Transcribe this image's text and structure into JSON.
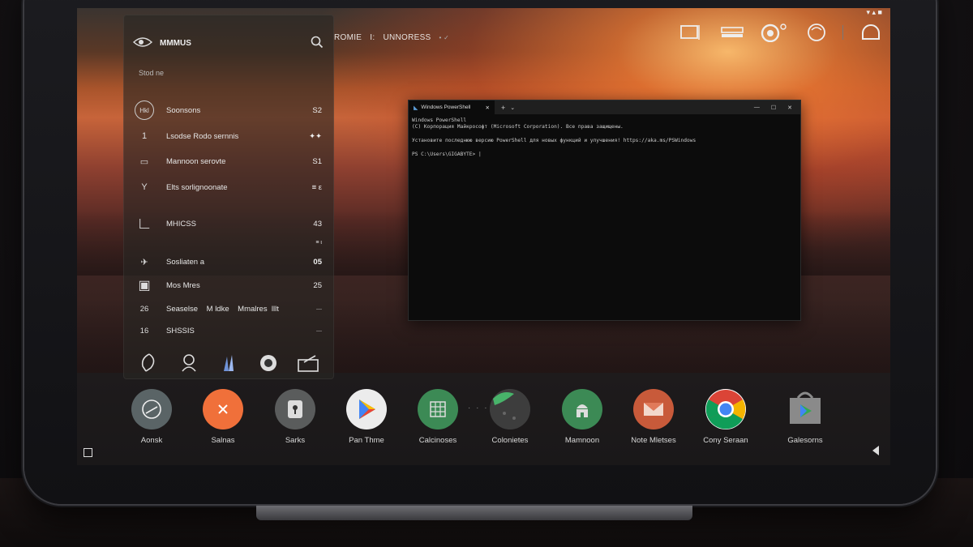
{
  "status_bar": {
    "text": "▾ ▴ ■"
  },
  "top_bar": {
    "title": "ROMIE",
    "separator": "I:",
    "subtitle": "UNNORESS",
    "suffix": "• ✓",
    "icons": [
      "screen-icon",
      "keyboard-icon",
      "camera-icon",
      "circle-icon",
      "headset-icon"
    ]
  },
  "panel": {
    "title": "MMMUS",
    "subheading": "Stod ne",
    "rows": [
      {
        "icon": "badge-icon",
        "glyph": "Hkl",
        "label": "Soonsons",
        "value": "S2"
      },
      {
        "icon": "number-icon",
        "glyph": "1",
        "label": "Lsodse Rodo sernnis",
        "value": "✦✦"
      },
      {
        "icon": "folder-icon",
        "glyph": "▭",
        "label": "Mannoon serovte",
        "value": "S1"
      },
      {
        "icon": "y-icon",
        "glyph": "Y",
        "label": "Elts sorlignoonate",
        "value": "≡ ε"
      },
      {
        "icon": "bracket-icon",
        "glyph": "∟",
        "label": "MHICSS",
        "value": "43"
      },
      {
        "icon": "plane-icon",
        "glyph": "✈",
        "label": "Sosliaten a",
        "value": "05"
      },
      {
        "icon": "truck-icon",
        "glyph": "▣",
        "label": "Mos Mres",
        "value": "25"
      },
      {
        "icon": "text-icon",
        "glyph": "26",
        "label": "Seaselse    M ldke    Mmalres  lllt",
        "value": "—"
      },
      {
        "icon": "text-icon",
        "glyph": "16",
        "label": "SHSSIS",
        "value": "—"
      }
    ],
    "small_mark": "≡ ι",
    "bottom_icons": [
      "feather-icon",
      "robot-icon",
      "chart-icon",
      "record-icon",
      "folder-edit-icon"
    ]
  },
  "powershell": {
    "tab_title": "Windows PowerShell",
    "lines": [
      "Windows PowerShell",
      "(C) Корпорация Майкрософт (Microsoft Corporation). Все права защищены.",
      "",
      "Установите последнюю версию PowerShell для новых функций и улучшения! https://aka.ms/PSWindows",
      "",
      "PS C:\\Users\\GIGABYTE> |"
    ]
  },
  "dock": {
    "items": [
      {
        "name": "aonsk",
        "label": "Aonsk",
        "icon": "steering-icon",
        "color": "#5a6466"
      },
      {
        "name": "salnas",
        "label": "Salnas",
        "icon": "close-icon",
        "color": "#f0703a"
      },
      {
        "name": "sarks",
        "label": "Sarks",
        "icon": "lock-icon",
        "color": "#5a5c5c"
      },
      {
        "name": "pan-thme",
        "label": "Pan Thme",
        "icon": "play-store-icon",
        "color": "#ececec"
      },
      {
        "name": "calcinoses",
        "label": "Calcinoses",
        "icon": "grid-icon",
        "color": "#3c8a55"
      },
      {
        "name": "colonietes",
        "label": "Colonietes",
        "icon": "globe-icon",
        "color": "#3a3a3a"
      },
      {
        "name": "mamnoon",
        "label": "Mamnoon",
        "icon": "android-icon",
        "color": "#3c8a55"
      },
      {
        "name": "note-mletses",
        "label": "Note Mletses",
        "icon": "mail-icon",
        "color": "#c85a3a"
      },
      {
        "name": "cony-seraan",
        "label": "Cony Seraan",
        "icon": "chrome-icon",
        "color": "#ffffff"
      },
      {
        "name": "galesorns",
        "label": "Galesorns",
        "icon": "store-bag-icon",
        "color": "#777"
      }
    ],
    "dots": "· · ·"
  }
}
